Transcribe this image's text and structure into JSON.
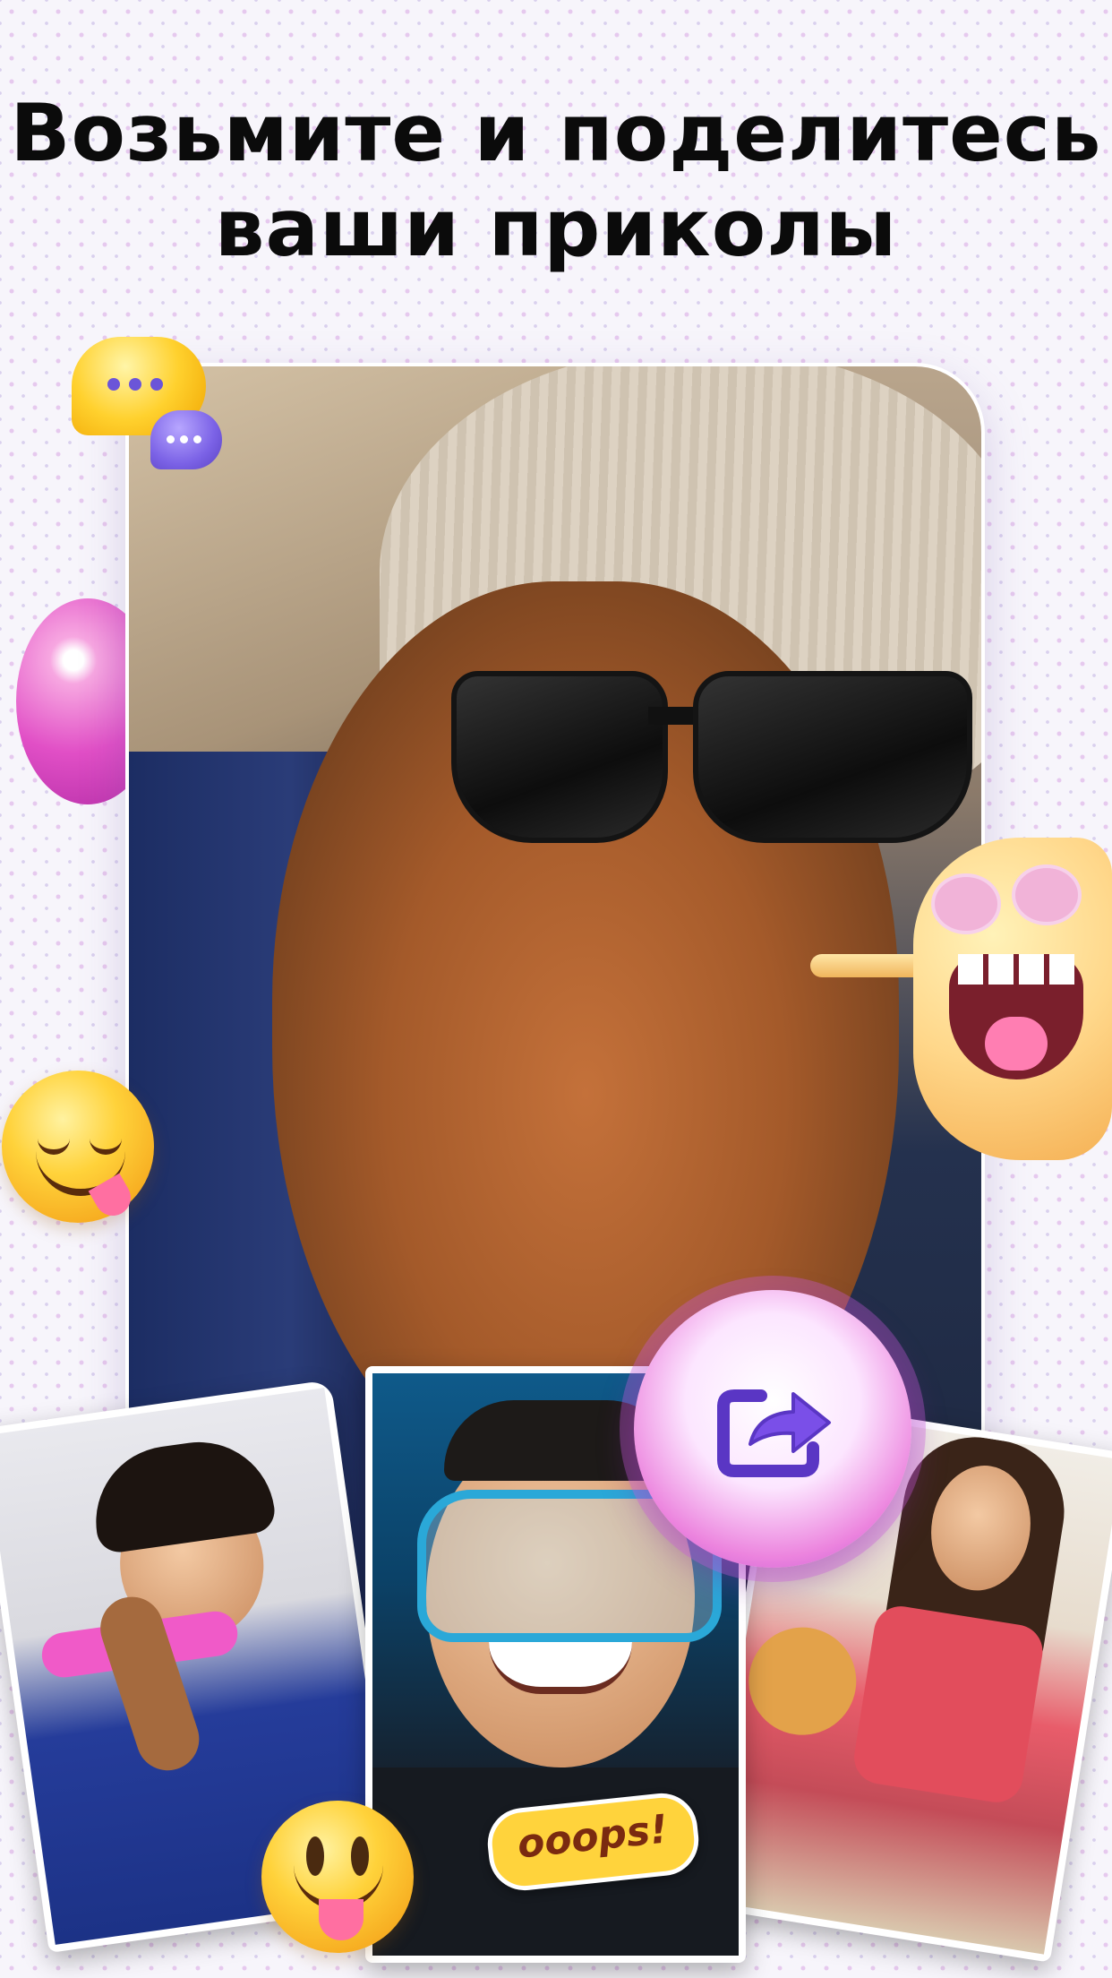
{
  "headline": {
    "line1": "Возьмите и поделитесь",
    "line2": "ваши приколы"
  },
  "sticker": {
    "oops": "ooops!"
  },
  "icons": {
    "share": "share-icon",
    "chat": "chat-bubbles-icon",
    "yum": "yum-emoji-icon",
    "tongue": "tongue-out-emoji-icon",
    "monster": "monster-sticker-icon"
  },
  "colors": {
    "accent": "#e14fc6",
    "share_icon": "#6a3fd6"
  }
}
